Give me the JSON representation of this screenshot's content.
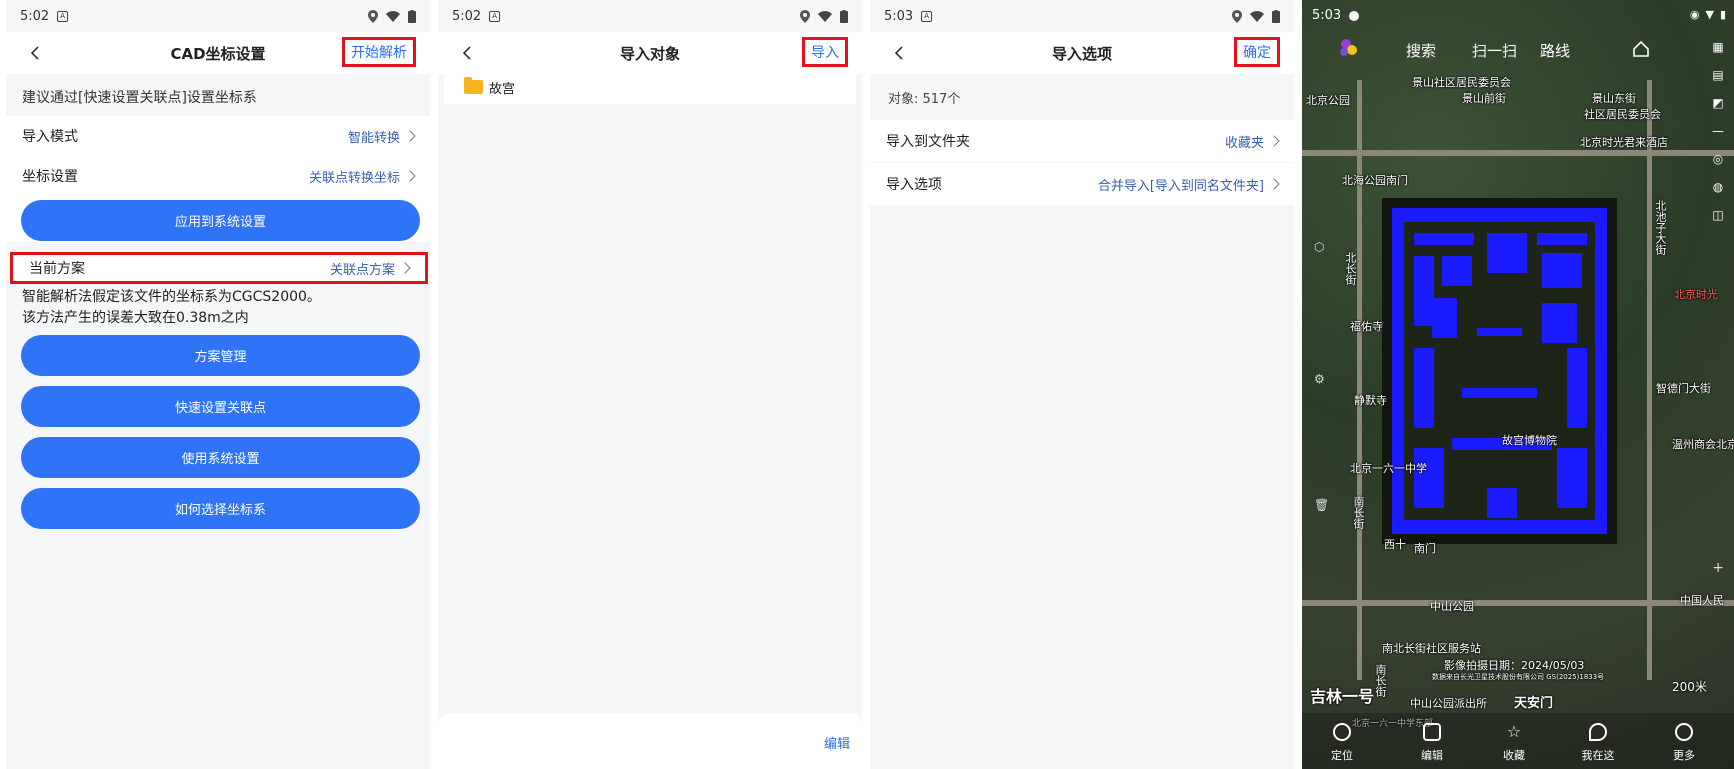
{
  "panel1": {
    "status": {
      "time": "5:02"
    },
    "title": "CAD坐标设置",
    "action": "开始解析",
    "hint": "建议通过[快速设置关联点]设置坐标系",
    "rows": [
      {
        "label": "导入模式",
        "value": "智能转换"
      },
      {
        "label": "坐标设置",
        "value": "关联点转换坐标"
      }
    ],
    "apply_button": "应用到系统设置",
    "current_scheme": {
      "label": "当前方案",
      "value": "关联点方案"
    },
    "note_line1": "智能解析法假定该文件的坐标系为CGCS2000。",
    "note_line2": "该方法产生的误差大致在0.38m之内",
    "buttons": [
      "方案管理",
      "快速设置关联点",
      "使用系统设置",
      "如何选择坐标系"
    ]
  },
  "panel2": {
    "status": {
      "time": "5:02"
    },
    "title": "导入对象",
    "action": "导入",
    "folder": "故宫",
    "edit": "编辑"
  },
  "panel3": {
    "status": {
      "time": "5:03"
    },
    "title": "导入选项",
    "action": "确定",
    "count": "对象: 517个",
    "rows": [
      {
        "label": "导入到文件夹",
        "value": "收藏夹"
      },
      {
        "label": "导入选项",
        "value": "合并导入[导入到同名文件夹]"
      }
    ]
  },
  "map": {
    "status": {
      "time": "5:03"
    },
    "nav": {
      "search": "搜索",
      "scan": "扫一扫",
      "route": "路线"
    },
    "labels": {
      "l1": "景山社区居民委员会",
      "l2": "北京公园",
      "l3": "景山东街",
      "l4": "社区居民委员会",
      "l5": "北京时光君来酒店",
      "l6": "北海公园南门",
      "l7": "北长街",
      "l8": "福佑寺",
      "l9": "静默寺",
      "l10": "故宫博物院",
      "l11": "北京一六一中学",
      "l12": "南长街",
      "l13": "中山公园",
      "l14": "南北长街社区服务站",
      "l15": "影像拍摄日期：2024/05/03",
      "l16": "数据来自长光卫星技术股份有限公司 GS(2025)1833号",
      "l17": "吉林一号",
      "l18": "中山公园派出所",
      "l19": "天安门",
      "l20": "200米",
      "l21": "北京一六一中学东部",
      "l22": "北池子大街",
      "l23": "北京时光",
      "l24": "智德门大街",
      "l25": "温州商会北京",
      "l26": "中国人民",
      "l27": "南长街",
      "l28": "西十",
      "l29": "南门",
      "l30": "景山前街"
    },
    "bottom": {
      "locate": "定位",
      "edit": "编辑",
      "collect": "收藏",
      "here": "我在这",
      "more": "更多"
    }
  }
}
